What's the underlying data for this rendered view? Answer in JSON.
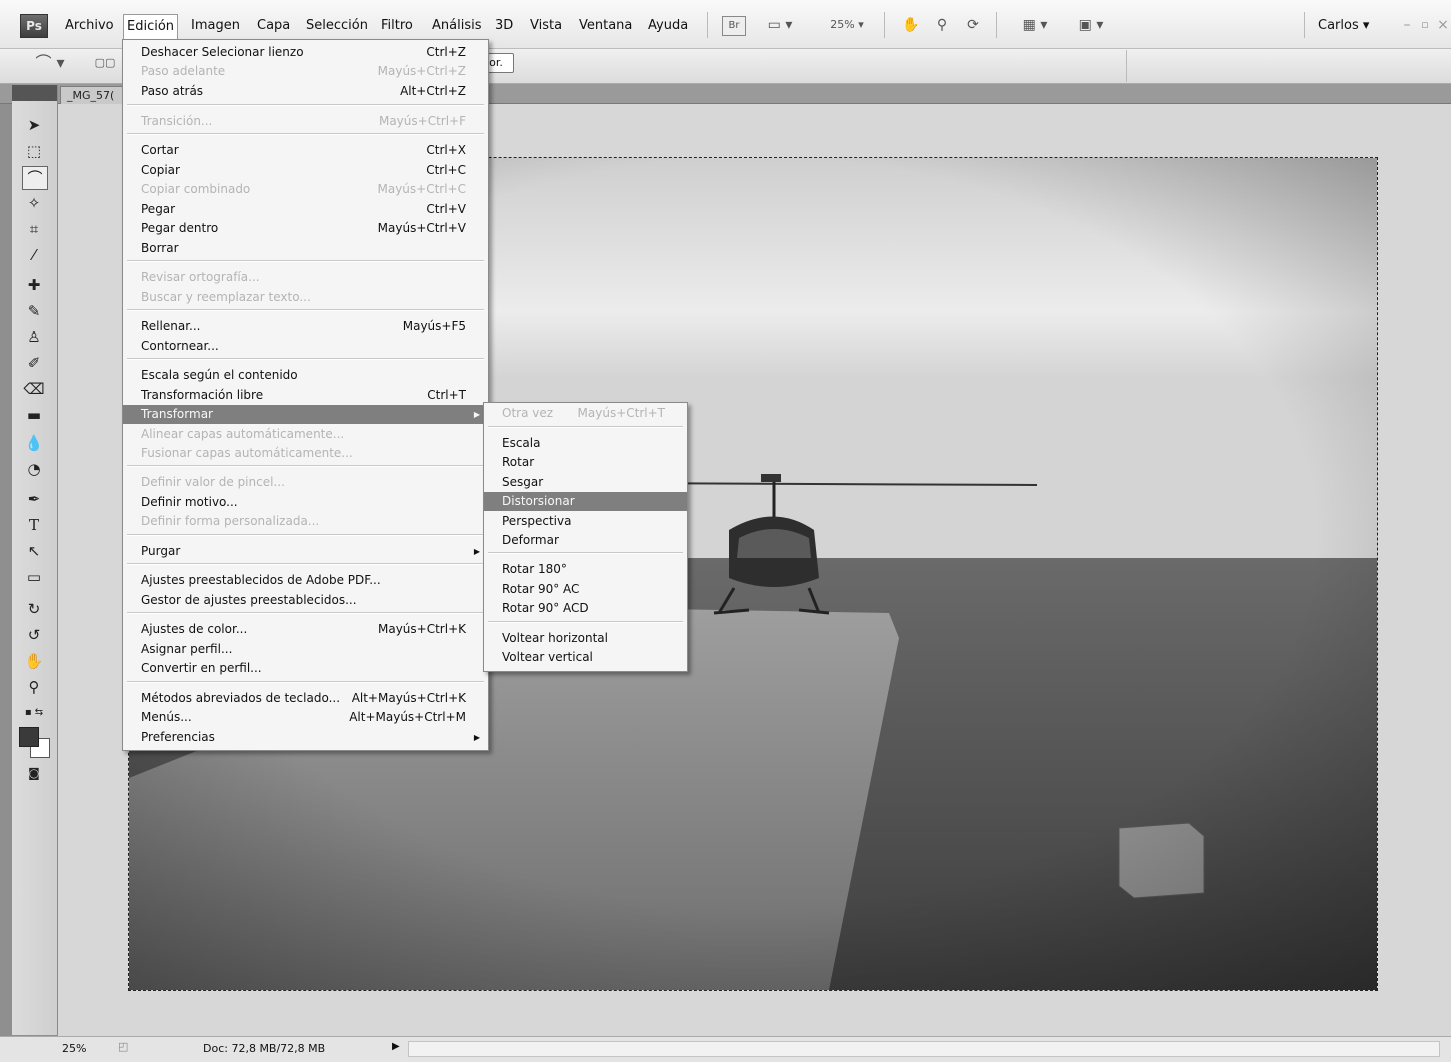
{
  "app": {
    "logo": "Ps",
    "user": "Carlos"
  },
  "menubar": {
    "items": [
      "Archivo",
      "Edición",
      "Imagen",
      "Capa",
      "Selección",
      "Filtro",
      "Análisis",
      "3D",
      "Vista",
      "Ventana",
      "Ayuda"
    ],
    "zoom": "25%",
    "bridge_label": "Br"
  },
  "options": {
    "button_label": "or."
  },
  "document": {
    "tab_label": "_MG_57("
  },
  "edit_menu": [
    {
      "label": "Deshacer Selecionar lienzo",
      "shortcut": "Ctrl+Z"
    },
    {
      "label": "Paso adelante",
      "shortcut": "Mayús+Ctrl+Z"
    },
    {
      "label": "Paso atrás",
      "shortcut": "Alt+Ctrl+Z"
    },
    {
      "label": "Transición...",
      "shortcut": "Mayús+Ctrl+F"
    },
    {
      "label": "Cortar",
      "shortcut": "Ctrl+X"
    },
    {
      "label": "Copiar",
      "shortcut": "Ctrl+C"
    },
    {
      "label": "Copiar combinado",
      "shortcut": "Mayús+Ctrl+C"
    },
    {
      "label": "Pegar",
      "shortcut": "Ctrl+V"
    },
    {
      "label": "Pegar dentro",
      "shortcut": "Mayús+Ctrl+V"
    },
    {
      "label": "Borrar",
      "shortcut": ""
    },
    {
      "label": "Revisar ortografía...",
      "shortcut": ""
    },
    {
      "label": "Buscar y reemplazar texto...",
      "shortcut": ""
    },
    {
      "label": "Rellenar...",
      "shortcut": "Mayús+F5"
    },
    {
      "label": "Contornear...",
      "shortcut": ""
    },
    {
      "label": "Escala según el contenido",
      "shortcut": ""
    },
    {
      "label": "Transformación libre",
      "shortcut": "Ctrl+T"
    },
    {
      "label": "Transformar",
      "shortcut": ""
    },
    {
      "label": "Alinear capas automáticamente...",
      "shortcut": ""
    },
    {
      "label": "Fusionar capas automáticamente...",
      "shortcut": ""
    },
    {
      "label": "Definir valor de pincel...",
      "shortcut": ""
    },
    {
      "label": "Definir motivo...",
      "shortcut": ""
    },
    {
      "label": "Definir forma personalizada...",
      "shortcut": ""
    },
    {
      "label": "Purgar",
      "shortcut": ""
    },
    {
      "label": "Ajustes preestablecidos de Adobe PDF...",
      "shortcut": ""
    },
    {
      "label": "Gestor de ajustes preestablecidos...",
      "shortcut": ""
    },
    {
      "label": "Ajustes de color...",
      "shortcut": "Mayús+Ctrl+K"
    },
    {
      "label": "Asignar perfil...",
      "shortcut": ""
    },
    {
      "label": "Convertir en perfil...",
      "shortcut": ""
    },
    {
      "label": "Métodos abreviados de teclado...",
      "shortcut": "Alt+Mayús+Ctrl+K"
    },
    {
      "label": "Menús...",
      "shortcut": "Alt+Mayús+Ctrl+M"
    },
    {
      "label": "Preferencias",
      "shortcut": ""
    }
  ],
  "transform_submenu": [
    {
      "label": "Otra vez",
      "shortcut": "Mayús+Ctrl+T"
    },
    {
      "label": "Escala",
      "shortcut": ""
    },
    {
      "label": "Rotar",
      "shortcut": ""
    },
    {
      "label": "Sesgar",
      "shortcut": ""
    },
    {
      "label": "Distorsionar",
      "shortcut": ""
    },
    {
      "label": "Perspectiva",
      "shortcut": ""
    },
    {
      "label": "Deformar",
      "shortcut": ""
    },
    {
      "label": "Rotar 180°",
      "shortcut": ""
    },
    {
      "label": "Rotar 90° AC",
      "shortcut": ""
    },
    {
      "label": "Rotar 90° ACD",
      "shortcut": ""
    },
    {
      "label": "Voltear horizontal",
      "shortcut": ""
    },
    {
      "label": "Voltear vertical",
      "shortcut": ""
    }
  ],
  "status": {
    "zoom": "25%",
    "doc_info": "Doc: 72,8 MB/72,8 MB"
  },
  "colors": {
    "menu_highlight": "#7f7f7f",
    "workspace": "#d7d7d7",
    "foreground_swatch": "#3a3a3a",
    "background_swatch": "#ffffff"
  }
}
